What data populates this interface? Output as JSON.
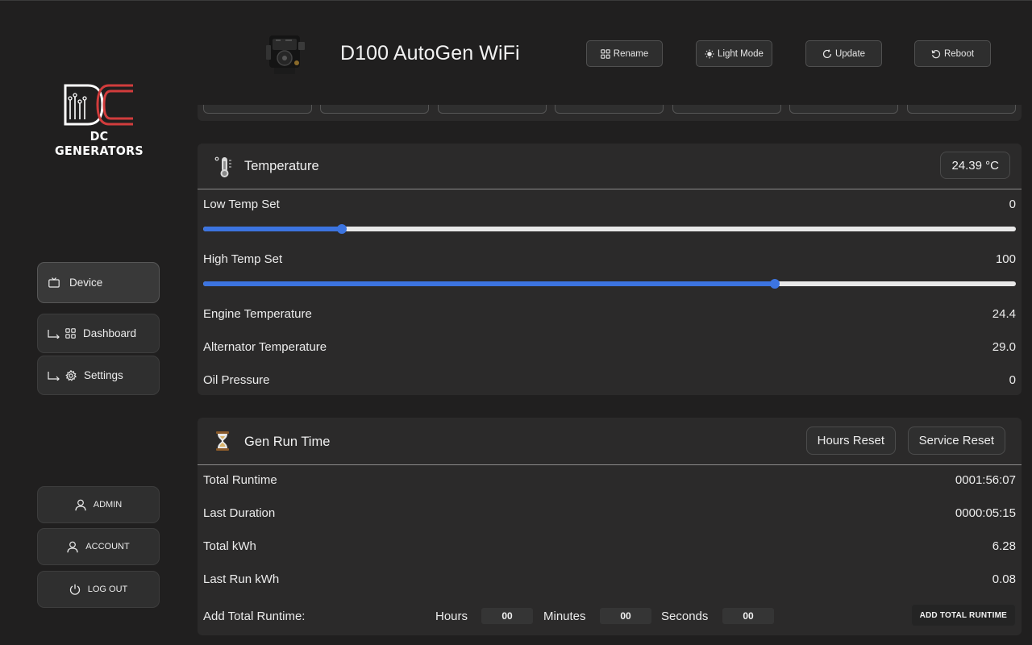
{
  "header": {
    "device_name": "D100 AutoGen WiFi",
    "buttons": {
      "rename": "Rename",
      "light_mode": "Light Mode",
      "update": "Update",
      "reboot": "Reboot"
    }
  },
  "brand": {
    "name": "DC GENERATORS"
  },
  "sidebar": {
    "nav": {
      "device": "Device",
      "dashboard": "Dashboard",
      "settings": "Settings"
    },
    "account": {
      "admin": "ADMIN",
      "account": "ACCOUNT",
      "logout": "LOG OUT"
    }
  },
  "temperature": {
    "title": "Temperature",
    "reading": "24.39 °C",
    "low_set": {
      "label": "Low Temp Set",
      "value": "0",
      "slider_fraction": 0.171
    },
    "high_set": {
      "label": "High Temp Set",
      "value": "100",
      "slider_fraction": 0.703
    },
    "rows": [
      {
        "label": "Engine Temperature",
        "value": "24.4"
      },
      {
        "label": "Alternator Temperature",
        "value": "29.0"
      },
      {
        "label": "Oil Pressure",
        "value": "0"
      }
    ]
  },
  "runtime": {
    "title": "Gen Run Time",
    "hours_reset": "Hours Reset",
    "service_reset": "Service Reset",
    "rows": [
      {
        "label": "Total Runtime",
        "value": "0001:56:07"
      },
      {
        "label": "Last Duration",
        "value": "0000:05:15"
      },
      {
        "label": "Total kWh",
        "value": "6.28"
      },
      {
        "label": "Last Run kWh",
        "value": "0.08"
      }
    ],
    "add": {
      "label": "Add Total Runtime:",
      "hours_label": "Hours",
      "hours_value": "00",
      "minutes_label": "Minutes",
      "minutes_value": "00",
      "seconds_label": "Seconds",
      "seconds_value": "00",
      "button": "ADD TOTAL RUNTIME"
    }
  },
  "colors": {
    "background": "#201f1f",
    "panel": "#2b2a2a",
    "accent_blue": "#3c74e0",
    "brand_red": "#d23c3c"
  },
  "icons": [
    "engine-image",
    "grid-icon",
    "sun-icon",
    "refresh-icon",
    "reboot-icon",
    "tv-icon",
    "arrow-corner-icon",
    "gear-icon",
    "user-icon",
    "power-icon",
    "thermometer-icon",
    "hourglass-icon"
  ]
}
